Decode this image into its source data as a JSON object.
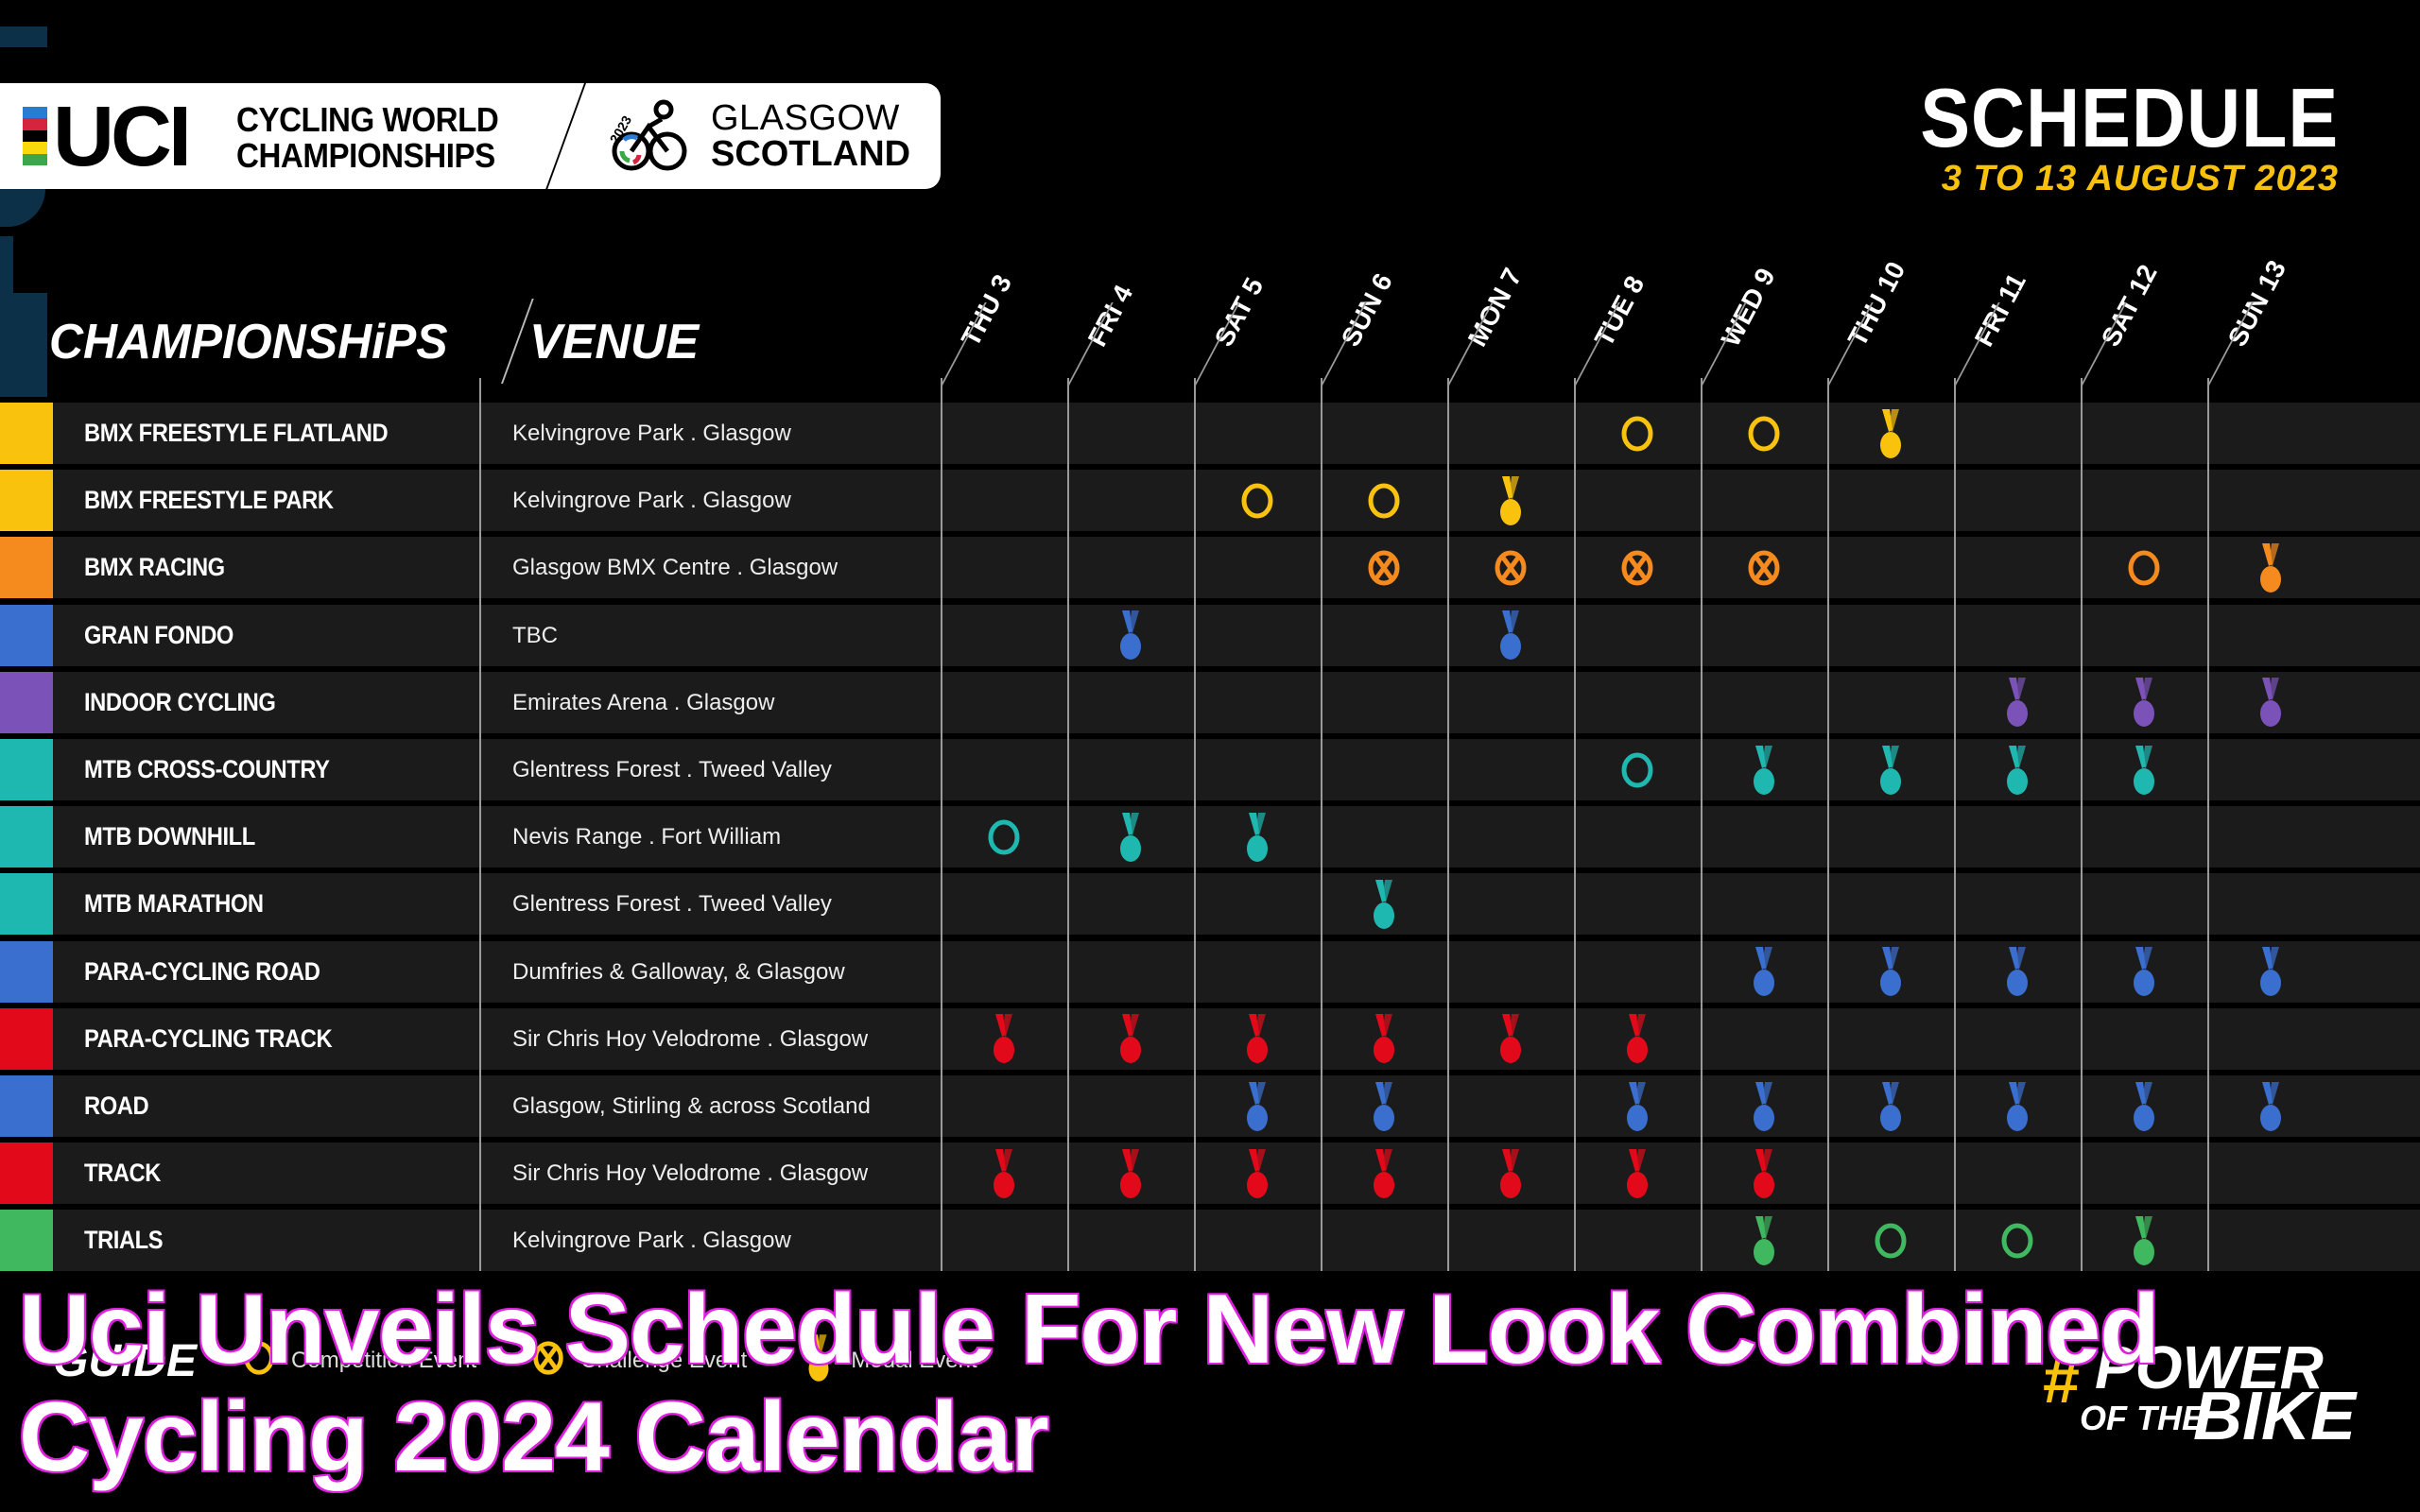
{
  "logo": {
    "uci": "UCI",
    "line1": "CYCLING WORLD",
    "line2": "CHAMPIONSHIPS",
    "badge_year": "2023",
    "city": "GLASGOW",
    "country": "SCOTLAND",
    "stripe_colors": [
      "#2a7bd3",
      "#d5243e",
      "#000000",
      "#f9d90b",
      "#3aa84a"
    ]
  },
  "header": {
    "title": "SCHEDULE",
    "dates": "3 TO 13 AUGUST 2023"
  },
  "table": {
    "col_championships": "CHAMPIONSHiPS",
    "col_venue": "VENUE",
    "days": [
      "THU 3",
      "FRI 4",
      "SAT 5",
      "SUN 6",
      "MON 7",
      "TUE 8",
      "WED 9",
      "THU 10",
      "FRI 11",
      "SAT 12",
      "SUN 13"
    ],
    "rows": [
      {
        "name": "BMX FREESTYLE FLATLAND",
        "venue": "Kelvingrove Park . Glasgow",
        "color": "#f9c20c",
        "events": [
          "",
          "",
          "",
          "",
          "",
          "competition",
          "competition",
          "medal",
          "",
          "",
          ""
        ]
      },
      {
        "name": "BMX FREESTYLE PARK",
        "venue": "Kelvingrove Park . Glasgow",
        "color": "#f9c20c",
        "events": [
          "",
          "",
          "competition",
          "competition",
          "medal",
          "",
          "",
          "",
          "",
          "",
          ""
        ]
      },
      {
        "name": "BMX RACING",
        "venue": "Glasgow BMX Centre . Glasgow",
        "color": "#f58a1f",
        "events": [
          "",
          "",
          "",
          "challenge",
          "challenge",
          "challenge",
          "challenge",
          "",
          "",
          "competition",
          "medal"
        ]
      },
      {
        "name": "GRAN FONDO",
        "venue": "TBC",
        "color": "#3a6fcf",
        "events": [
          "",
          "medal",
          "",
          "",
          "medal",
          "",
          "",
          "",
          "",
          "",
          ""
        ]
      },
      {
        "name": "INDOOR CYCLING",
        "venue": "Emirates Arena . Glasgow",
        "color": "#7b52b8",
        "events": [
          "",
          "",
          "",
          "",
          "",
          "",
          "",
          "",
          "medal",
          "medal",
          "medal"
        ]
      },
      {
        "name": "MTB CROSS-COUNTRY",
        "venue": "Glentress Forest . Tweed Valley",
        "color": "#1fb8b0",
        "events": [
          "",
          "",
          "",
          "",
          "",
          "competition",
          "medal",
          "medal",
          "medal",
          "medal",
          ""
        ]
      },
      {
        "name": "MTB DOWNHILL",
        "venue": "Nevis Range . Fort William",
        "color": "#1fb8b0",
        "events": [
          "competition",
          "medal",
          "medal",
          "",
          "",
          "",
          "",
          "",
          "",
          "",
          ""
        ]
      },
      {
        "name": "MTB MARATHON",
        "venue": "Glentress Forest . Tweed Valley",
        "color": "#1fb8b0",
        "events": [
          "",
          "",
          "",
          "medal",
          "",
          "",
          "",
          "",
          "",
          "",
          ""
        ]
      },
      {
        "name": "PARA-CYCLING ROAD",
        "venue": "Dumfries & Galloway, & Glasgow",
        "color": "#3a6fcf",
        "events": [
          "",
          "",
          "",
          "",
          "",
          "",
          "medal",
          "medal",
          "medal",
          "medal",
          "medal"
        ]
      },
      {
        "name": "PARA-CYCLING TRACK",
        "venue": "Sir Chris Hoy Velodrome . Glasgow",
        "color": "#e20a1a",
        "events": [
          "medal",
          "medal",
          "medal",
          "medal",
          "medal",
          "medal",
          "",
          "",
          "",
          "",
          ""
        ]
      },
      {
        "name": "ROAD",
        "venue": "Glasgow, Stirling & across Scotland",
        "color": "#3a6fcf",
        "events": [
          "",
          "",
          "medal",
          "medal",
          "",
          "medal",
          "medal",
          "medal",
          "medal",
          "medal",
          "medal"
        ]
      },
      {
        "name": "TRACK",
        "venue": "Sir Chris Hoy Velodrome . Glasgow",
        "color": "#e20a1a",
        "events": [
          "medal",
          "medal",
          "medal",
          "medal",
          "medal",
          "medal",
          "medal",
          "",
          "",
          "",
          ""
        ]
      },
      {
        "name": "TRIALS",
        "venue": "Kelvingrove Park . Glasgow",
        "color": "#3fb860",
        "events": [
          "",
          "",
          "",
          "",
          "",
          "",
          "medal",
          "competition",
          "competition",
          "medal",
          ""
        ]
      }
    ]
  },
  "legend": {
    "title": "GUIDE",
    "items": [
      {
        "type": "competition",
        "label": "Competition Event"
      },
      {
        "type": "challenge",
        "label": "Challenge Event"
      },
      {
        "type": "medal",
        "label": "Medal Event"
      }
    ],
    "color": "#f9c20c"
  },
  "tagline": {
    "hash": "#",
    "word1": "POWER",
    "word2": "OF THE",
    "word3": "BIKE"
  },
  "overlay_headline": "Uci Unveils Schedule For New Look Combined Cycling 2024 Calendar"
}
